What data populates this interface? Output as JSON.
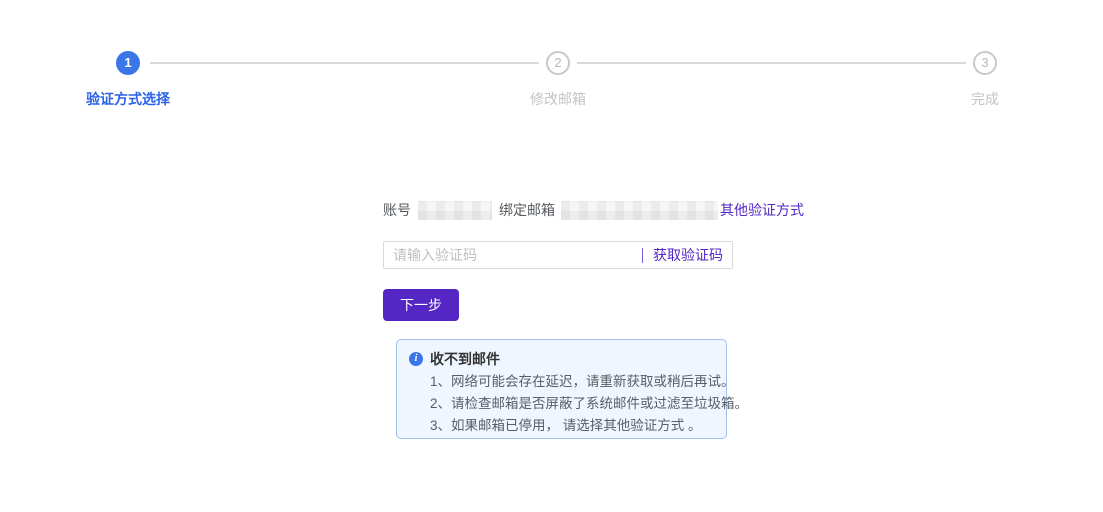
{
  "colors": {
    "active_blue": "#3b76e8",
    "active_label_blue": "#2b63e8",
    "accent_purple": "#5426c4",
    "pending_gray": "#c9c9c9",
    "connector_gray": "#d9d9d9",
    "notice_bg": "#f0f6ff",
    "notice_border": "#9fc0ee"
  },
  "stepper": {
    "steps": [
      {
        "number": "1",
        "label": "验证方式选择",
        "state": "active"
      },
      {
        "number": "2",
        "label": "修改邮箱",
        "state": "pending"
      },
      {
        "number": "3",
        "label": "完成",
        "state": "pending"
      }
    ]
  },
  "form": {
    "account_label": "账号",
    "bind_email_label": "绑定邮箱",
    "other_method_link": "其他验证方式",
    "code_placeholder": "请输入验证码",
    "get_code_label": "获取验证码",
    "next_label": "下一步"
  },
  "notice": {
    "title": "收不到邮件",
    "items": [
      "1、网络可能会存在延迟，请重新获取或稍后再试。",
      "2、请检查邮箱是否屏蔽了系统邮件或过滤至垃圾箱。",
      "3、如果邮箱已停用， 请选择其他验证方式 。"
    ]
  }
}
